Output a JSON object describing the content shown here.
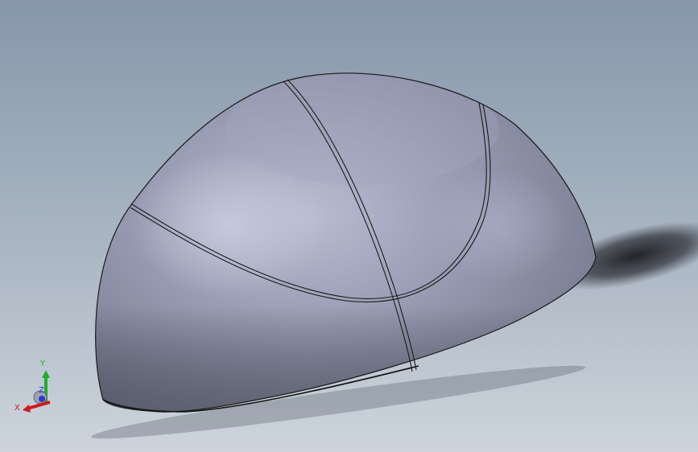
{
  "viewport": {
    "colors": {
      "background_top": "#8a9aac",
      "background_bottom": "#c9d1da",
      "model_light": "#b7bbd0",
      "model_mid": "#8f93a8",
      "model_dark": "#6c7083",
      "edge": "#1a1a1a"
    },
    "model": {
      "name": "hemisphere-ball-segment"
    }
  },
  "triad": {
    "x_label": "X",
    "y_label": "Y",
    "z_label": "Z",
    "colors": {
      "x": "#d11919",
      "y": "#1fae2a",
      "z": "#2b3bd1"
    }
  }
}
